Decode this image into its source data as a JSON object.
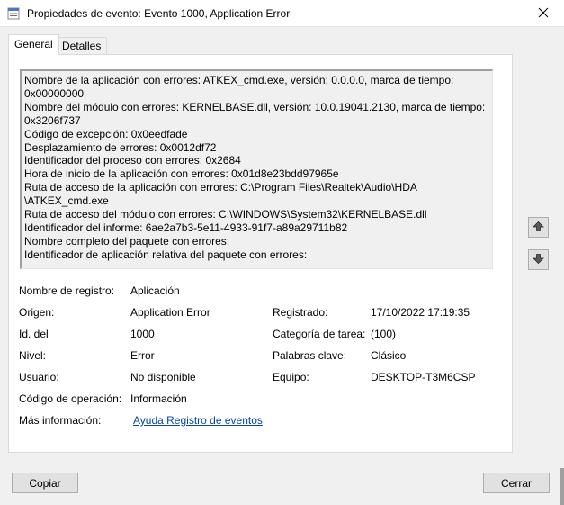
{
  "window": {
    "title": "Propiedades de evento: Evento 1000, Application Error"
  },
  "tabs": [
    {
      "label": "General",
      "active": true
    },
    {
      "label": "Detalles",
      "active": false
    }
  ],
  "description": [
    "Nombre de la aplicación con errores: ATKEX_cmd.exe, versión: 0.0.0.0, marca de tiempo:",
    "0x00000000",
    "Nombre del módulo con errores: KERNELBASE.dll, versión: 10.0.19041.2130, marca de tiempo:",
    "0x3206f737",
    "Código de excepción: 0x0eedfade",
    "Desplazamiento de errores: 0x0012df72",
    "Identificador del proceso con errores: 0x2684",
    "Hora de inicio de la aplicación con errores: 0x01d8e23bdd97965e",
    "Ruta de acceso de la aplicación con errores: C:\\Program Files\\Realtek\\Audio\\HDA",
    "\\ATKEX_cmd.exe",
    "Ruta de acceso del módulo con errores: C:\\WINDOWS\\System32\\KERNELBASE.dll",
    "Identificador del informe: 6ae2a7b3-5e11-4933-91f7-a89a29711b82",
    "Nombre completo del paquete con errores:",
    "Identificador de aplicación relativa del paquete con errores:"
  ],
  "fields": {
    "log_name": {
      "label": "Nombre de registro:",
      "value": "Aplicación"
    },
    "source": {
      "label": "Origen:",
      "value": "Application Error"
    },
    "logged": {
      "label": "Registrado:",
      "value": "17/10/2022 17:19:35"
    },
    "event_id": {
      "label": "Id. del",
      "value": "1000"
    },
    "task_category": {
      "label": "Categoría de tarea:",
      "value": "(100)"
    },
    "level": {
      "label": "Nivel:",
      "value": "Error"
    },
    "keywords": {
      "label": "Palabras clave:",
      "value": "Clásico"
    },
    "user": {
      "label": "Usuario:",
      "value": "No disponible"
    },
    "computer": {
      "label": "Equipo:",
      "value": "DESKTOP-T3M6CSP"
    },
    "opcode": {
      "label": "Código de operación:",
      "value": "Información"
    },
    "more_info": {
      "label": "Más información:",
      "value": "Ayuda Registro de eventos"
    }
  },
  "buttons": {
    "copy": "Copiar",
    "close": "Cerrar"
  },
  "icons": {
    "close": "close-icon",
    "up": "arrow-up-icon",
    "down": "arrow-down-icon",
    "app": "event-viewer-icon"
  },
  "colors": {
    "link": "#0645ad",
    "window_bg": "#f0f0f0"
  }
}
